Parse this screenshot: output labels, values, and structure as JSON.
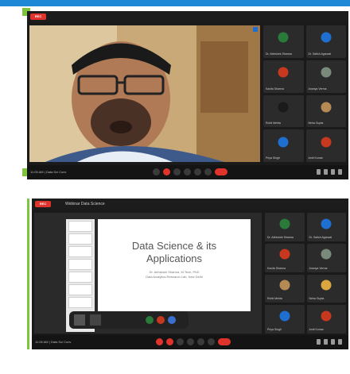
{
  "panels": [
    {
      "rec_badge": "REC",
      "footer_left": "11:05 AM  |  Data Sci Conv",
      "tiles": [
        {
          "label": "Dr. Abhishek Sharma",
          "avatar_color": "#2a7a3a"
        },
        {
          "label": "Dr. Satish Agarwal",
          "avatar_color": "#1f6fd0"
        },
        {
          "label": "Kavita Sharma",
          "avatar_color": "#c7391f"
        },
        {
          "label": "Ananya Verma",
          "avatar_color": "#7a8a7a"
        },
        {
          "label": "Rohit Mehta",
          "avatar_color": "#1a1a1a"
        },
        {
          "label": "Neha Gupta",
          "avatar_color": "#b58a55"
        },
        {
          "label": "Priya Singh",
          "avatar_color": "#1f6fd0"
        },
        {
          "label": "Amit Kumar",
          "avatar_color": "#c7391f"
        }
      ]
    },
    {
      "rec_badge": "REC",
      "header_title": "Webinar Data Science",
      "footer_left": "11:06 AM  |  Data Sci Conv",
      "slide": {
        "title_line1": "Data Science & its",
        "title_line2": "Applications",
        "sub1": "Dr. Abhishek Sharma, M.Tech, PhD",
        "sub2": "Data Analytics Research Lab, New Delhi"
      },
      "tiles": [
        {
          "label": "Dr. Abhishek Sharma",
          "avatar_color": "#2a7a3a"
        },
        {
          "label": "Dr. Satish Agarwal",
          "avatar_color": "#1f6fd0"
        },
        {
          "label": "Kavita Sharma",
          "avatar_color": "#c7391f"
        },
        {
          "label": "Ananya Verma",
          "avatar_color": "#7a8a7a"
        },
        {
          "label": "Rohit Mehta",
          "avatar_color": "#b58a55"
        },
        {
          "label": "Neha Gupta",
          "avatar_color": "#d9a640"
        },
        {
          "label": "Priya Singh",
          "avatar_color": "#1f6fd0"
        },
        {
          "label": "Amit Kumar",
          "avatar_color": "#c7391f"
        }
      ]
    }
  ]
}
